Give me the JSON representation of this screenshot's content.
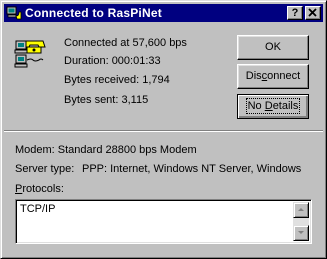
{
  "window": {
    "title": "Connected to RasPiNet",
    "help_label": "?",
    "close_label": "✕"
  },
  "status": {
    "connected": "Connected at 57,600 bps",
    "duration": "Duration:  000:01:33",
    "received": "Bytes received:  1,794",
    "sent": "Bytes sent:  3,115"
  },
  "buttons": {
    "ok": "OK",
    "disconnect_pre": "Dis",
    "disconnect_u": "c",
    "disconnect_post": "onnect",
    "details_pre": "No ",
    "details_u": "D",
    "details_post": "etails"
  },
  "details": {
    "modem": "Modem: Standard 28800 bps Modem",
    "server_label": "Server type:",
    "server_value": "PPP: Internet, Windows NT Server, Windows",
    "protocols_u": "P",
    "protocols_rest": "rotocols:",
    "protocols": [
      "TCP/IP"
    ]
  },
  "icons": {
    "title": "dialup-network-icon",
    "status": "connected-computers-icon"
  }
}
